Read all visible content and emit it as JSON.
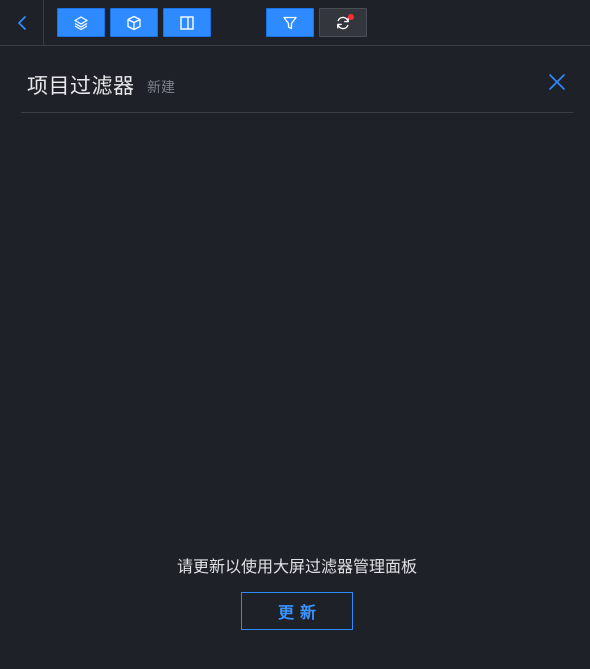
{
  "toolbar": {
    "back_icon": "chevron-left-icon",
    "buttons": [
      {
        "name": "layers-button",
        "icon": "layers-icon"
      },
      {
        "name": "cube-button",
        "icon": "cube-icon"
      },
      {
        "name": "split-panel-button",
        "icon": "split-panel-icon"
      },
      {
        "name": "filter-button",
        "icon": "filter-icon"
      },
      {
        "name": "refresh-button",
        "icon": "refresh-icon",
        "has_notification_dot": true
      }
    ]
  },
  "panel": {
    "title": "项目过滤器",
    "subtitle": "新建",
    "close_icon": "close-icon"
  },
  "empty_state": {
    "message": "请更新以使用大屏过滤器管理面板",
    "update_label": "更新"
  },
  "colors": {
    "background": "#1e2127",
    "accent": "#2e8bff",
    "divider": "#3a3d44",
    "notification": "#ff2d2d"
  }
}
